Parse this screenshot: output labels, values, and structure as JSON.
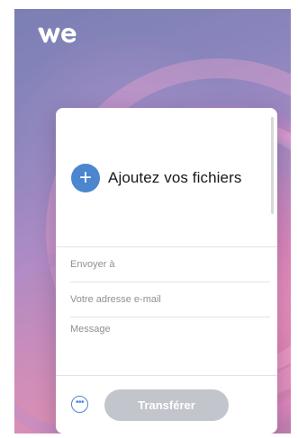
{
  "app": {
    "logo_icon": "wetransfer-logo-icon"
  },
  "uploader": {
    "add_files_icon": "plus-icon",
    "add_files_label": "Ajoutez vos fichiers"
  },
  "form": {
    "recipient_placeholder": "Envoyer à",
    "recipient_value": "",
    "sender_placeholder": "Votre adresse e-mail",
    "sender_value": "",
    "message_placeholder": "Message",
    "message_value": ""
  },
  "footer": {
    "more_options_icon": "ellipsis-circle-icon",
    "transfer_label": "Transférer"
  },
  "colors": {
    "accent": "#4b86cf",
    "disabled_button": "#c2c5cb",
    "text_primary": "#17181a",
    "placeholder": "#8e9096"
  }
}
